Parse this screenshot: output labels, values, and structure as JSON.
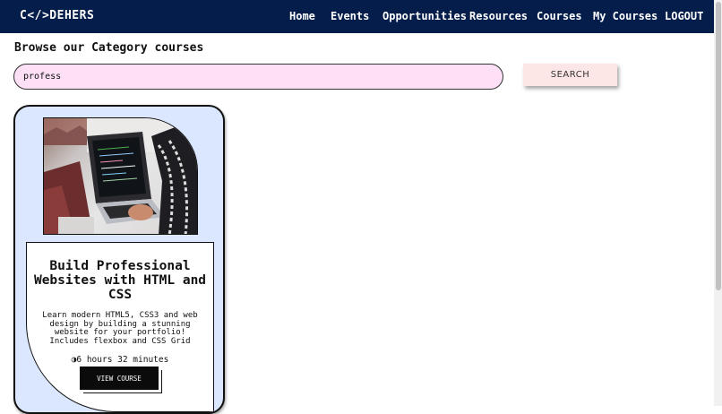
{
  "nav": {
    "logo": "C</>DEHERS",
    "links": [
      "Home",
      "Events",
      "Opportunities",
      "Resources",
      "Courses",
      "My Courses",
      "LOGOUT"
    ]
  },
  "page": {
    "heading": "Browse our Category courses"
  },
  "search": {
    "value": "profess",
    "button_label": "SEARCH"
  },
  "courses": [
    {
      "title": "Build Professional Websites with HTML and CSS",
      "description": "Learn modern HTML5, CSS3 and web design by building a stunning website for your portfolio! Includes flexbox and CSS Grid",
      "duration_icon": "clock-icon",
      "duration": "6 hours 32 minutes",
      "button_label": "VIEW COURSE"
    }
  ],
  "colors": {
    "navbar": "#041d4a",
    "search_bg": "#fde0f5",
    "card_bg": "#dbe6ff",
    "button_bg": "#0b0b0b"
  }
}
